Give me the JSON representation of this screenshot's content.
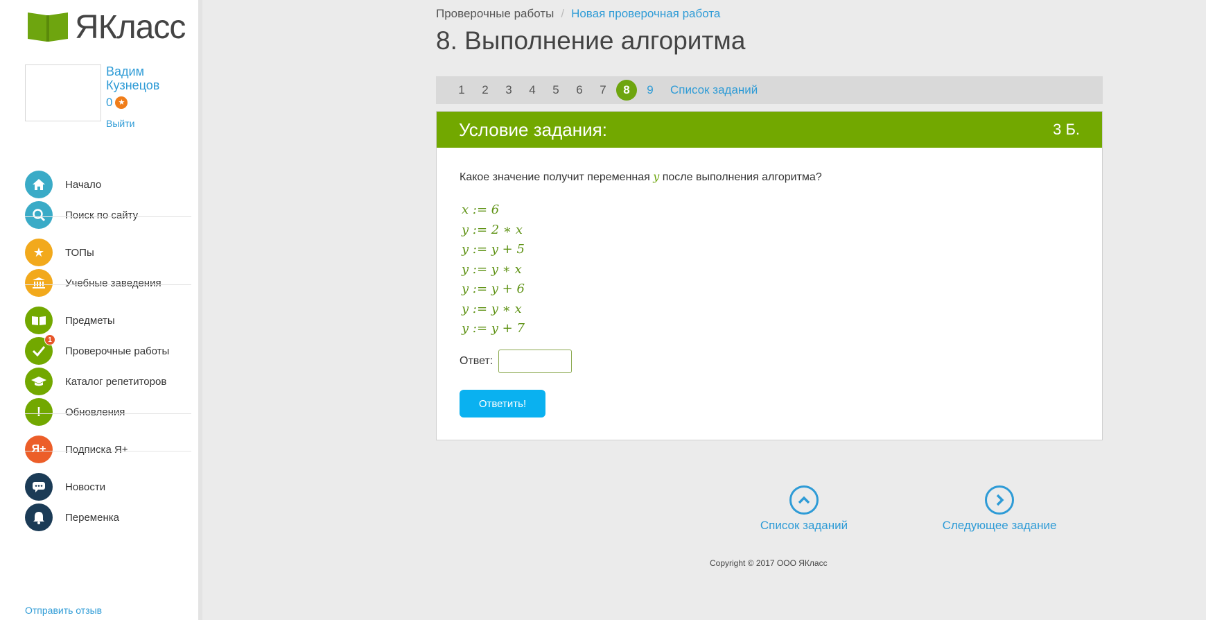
{
  "brand": {
    "name": "ЯКласс"
  },
  "user": {
    "first_name": "Вадим",
    "last_name": "Кузнецов",
    "points": "0",
    "logout": "Выйти"
  },
  "nav": [
    {
      "label": "Начало",
      "icon": "home-icon",
      "color": "#3aabc7"
    },
    {
      "label": "Поиск по сайту",
      "icon": "search-icon",
      "color": "#3aabc7"
    },
    {
      "label": "ТОПы",
      "icon": "star-icon",
      "color": "#f2a91c"
    },
    {
      "label": "Учебные заведения",
      "icon": "institution-icon",
      "color": "#f2a91c"
    },
    {
      "label": "Предметы",
      "icon": "book-icon",
      "color": "#72a800"
    },
    {
      "label": "Проверочные работы",
      "icon": "check-icon",
      "color": "#72a800",
      "badge": "1"
    },
    {
      "label": "Каталог репетиторов",
      "icon": "graduation-cap-icon",
      "color": "#72a800"
    },
    {
      "label": "Обновления",
      "icon": "exclamation-icon",
      "color": "#72a800"
    },
    {
      "label": "Подписка Я+",
      "icon": "ya-plus-icon",
      "color": "#ec5e29"
    },
    {
      "label": "Новости",
      "icon": "chat-icon",
      "color": "#1b3b56"
    },
    {
      "label": "Переменка",
      "icon": "bell-icon",
      "color": "#1b3b56"
    }
  ],
  "feedback": "Отправить отзыв",
  "breadcrumb": {
    "parent": "Проверочные работы",
    "separator": "/",
    "current": "Новая проверочная работа"
  },
  "page_title": "8. Выполнение алгоритма",
  "pager": {
    "items": [
      "1",
      "2",
      "3",
      "4",
      "5",
      "6",
      "7",
      "8",
      "9"
    ],
    "current": "8",
    "list_label": "Список заданий"
  },
  "task": {
    "header_title": "Условие задания:",
    "score": "3 Б.",
    "question_before": "Какое значение получит переменная ",
    "question_var": "y",
    "question_after": " после выполнения алгоритма?",
    "code_lines": [
      "x := 6",
      "y := 2 ∗ x",
      "y := y + 5",
      "y := y ∗ x",
      "y := y + 6",
      "y := y ∗ x",
      "y := y + 7"
    ],
    "answer_label": "Ответ:",
    "answer_value": "",
    "submit_label": "Ответить!"
  },
  "bottom_nav": {
    "list_label": "Список заданий",
    "next_label": "Следующее задание"
  },
  "copyright": "Copyright © 2017 ООО ЯКласс"
}
